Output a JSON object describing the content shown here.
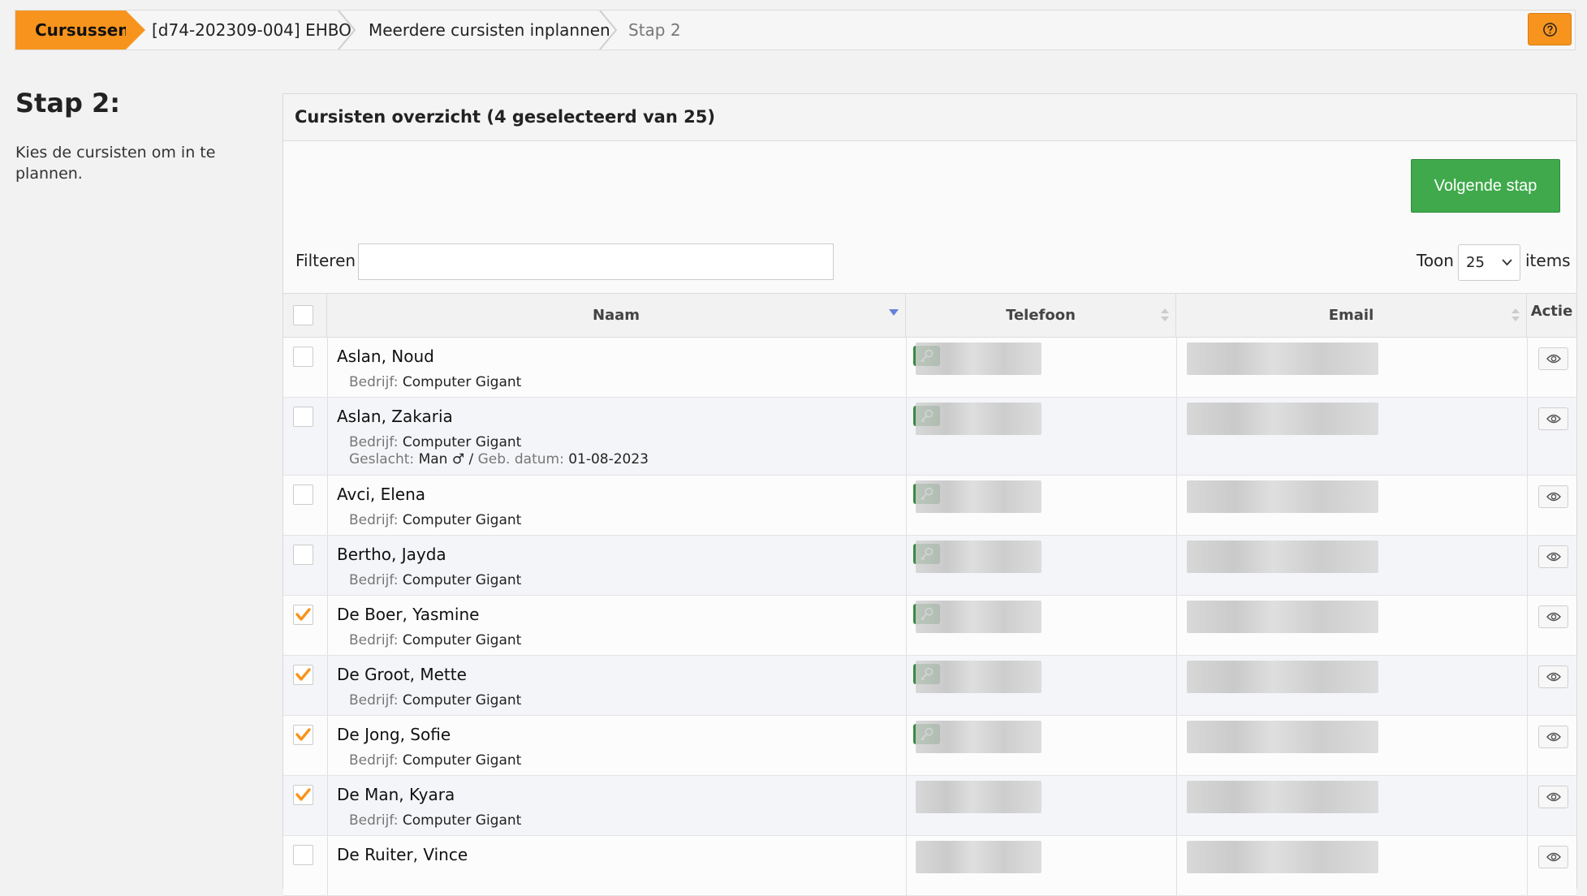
{
  "breadcrumb": {
    "items": [
      "Cursussen",
      "[d74-202309-004] EHBO",
      "Meerdere cursisten inplannen",
      "Stap 2"
    ],
    "help_icon": "question-circle-icon"
  },
  "left": {
    "title": "Stap 2:",
    "description": "Kies de cursisten om in te plannen."
  },
  "panel": {
    "title": "Cursisten overzicht (4 geselecteerd van 25)",
    "next_button": "Volgende stap",
    "filter_label": "Filteren",
    "filter_value": "",
    "toon_label": "Toon",
    "toon_value": "25",
    "items_label": "items"
  },
  "table": {
    "columns": [
      "Naam",
      "Telefoon",
      "Email",
      "Actie"
    ],
    "rows": [
      {
        "name": "Aslan, Noud",
        "bedrijf_label": "Bedrijf:",
        "bedrijf": "Computer Gigant",
        "checked": false,
        "key": true
      },
      {
        "name": "Aslan, Zakaria",
        "bedrijf_label": "Bedrijf:",
        "bedrijf": "Computer Gigant",
        "checked": false,
        "key": true,
        "geslacht_label": "Geslacht:",
        "geslacht": "Man ♂",
        "sep": " / ",
        "geb_label": "Geb. datum:",
        "geb": "01-08-2023"
      },
      {
        "name": "Avci, Elena",
        "bedrijf_label": "Bedrijf:",
        "bedrijf": "Computer Gigant",
        "checked": false,
        "key": true
      },
      {
        "name": "Bertho, Jayda",
        "bedrijf_label": "Bedrijf:",
        "bedrijf": "Computer Gigant",
        "checked": false,
        "key": true
      },
      {
        "name": "De Boer, Yasmine",
        "bedrijf_label": "Bedrijf:",
        "bedrijf": "Computer Gigant",
        "checked": true,
        "key": true
      },
      {
        "name": "De Groot, Mette",
        "bedrijf_label": "Bedrijf:",
        "bedrijf": "Computer Gigant",
        "checked": true,
        "key": true
      },
      {
        "name": "De Jong, Sofie",
        "bedrijf_label": "Bedrijf:",
        "bedrijf": "Computer Gigant",
        "checked": true,
        "key": true
      },
      {
        "name": "De Man, Kyara",
        "bedrijf_label": "Bedrijf:",
        "bedrijf": "Computer Gigant",
        "checked": true,
        "key": false
      },
      {
        "name": "De Ruiter, Vince",
        "bedrijf_label": "",
        "bedrijf": "",
        "checked": false,
        "key": false
      }
    ]
  },
  "colors": {
    "accent": "#f7941d",
    "success": "#3fa94b",
    "key": "#3a8a44"
  }
}
